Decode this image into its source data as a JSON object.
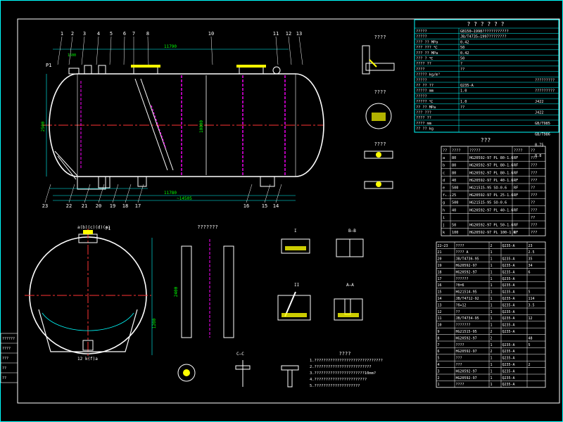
{
  "title_block": {
    "header": "? ? ? ? ? ?",
    "rows": [
      [
        "?????",
        "GB150—1998????????????"
      ],
      [
        "?????",
        "JB/T4735—1997????????"
      ],
      [
        "??? ?? MPa",
        "0.42"
      ],
      [
        "??? ??? ℃",
        "50"
      ],
      [
        "??? ?? MPa",
        "0.42"
      ],
      [
        "??? ? ℃",
        "50"
      ],
      [
        "???? ??",
        "?"
      ],
      [
        "????",
        "??"
      ],
      [
        "????? kg/m³",
        ""
      ],
      [
        "?????",
        ""
      ],
      [
        "?? ?? ??",
        "Q235-A"
      ],
      [
        "????? mm",
        "1.0"
      ],
      [
        "?????",
        ""
      ],
      [
        "????? ℃",
        "1.0"
      ],
      [
        "?? ?? MPa",
        "??"
      ],
      [
        "??? ???",
        ""
      ],
      [
        "???? ??",
        ""
      ],
      [
        "???? mm",
        ""
      ],
      [
        "?? ?? kg",
        ""
      ]
    ],
    "right_cells": [
      "?????????",
      "?????????",
      "J422",
      "J422",
      "GB/T985",
      "GB/T986",
      "0.75",
      "0.8"
    ]
  },
  "nozzle_table": {
    "title": "???",
    "headers": [
      "??",
      "????",
      "?????",
      "????",
      "??"
    ],
    "rows": [
      [
        "a",
        "80",
        "HG20592-97 PL 80-1.6",
        "RF",
        "???"
      ],
      [
        "b",
        "80",
        "HG20592-97 PL 80-1.6",
        "RF",
        "???"
      ],
      [
        "c",
        "80",
        "HG20592-97 PL 80-1.6",
        "RF",
        "???"
      ],
      [
        "d",
        "40",
        "HG20592-97 PL 40-1.6",
        "RF",
        "???"
      ],
      [
        "e",
        "500",
        "HG21515-95 SO-0.6",
        "RF",
        "??"
      ],
      [
        "f₁₋₃",
        "25",
        "HG20592-97 PL 25-1.6",
        "RF",
        "???"
      ],
      [
        "g",
        "500",
        "HG21515-95 SO-0.6",
        "",
        "??"
      ],
      [
        "h",
        "40",
        "HG20592-97 PL 40-1.6",
        "RF",
        "???"
      ],
      [
        "i",
        "",
        "",
        "",
        "??"
      ],
      [
        "j",
        "50",
        "HG20592-97 PL 50-1.6",
        "RF",
        "???"
      ],
      [
        "k",
        "100",
        "HG20592-97 PL 100-1.6",
        "RF",
        "???"
      ]
    ]
  },
  "parts_list": {
    "rows": [
      [
        "22—23",
        "????",
        "2",
        "Q235-A",
        "23"
      ],
      [
        "21",
        "???? A",
        "1",
        "",
        "2.5"
      ],
      [
        "20",
        "JB/T4736-95",
        "1",
        "Q235-A",
        "35"
      ],
      [
        "19",
        "HG20592-97",
        "1",
        "Q235-A",
        "34"
      ],
      [
        "18",
        "HG20592-97",
        "1",
        "Q235-A",
        "6"
      ],
      [
        "17",
        "??????",
        "1",
        "Q235-A",
        ""
      ],
      [
        "16",
        "?δ=6",
        "1",
        "Q235-A",
        ""
      ],
      [
        "15",
        "HG21514-95",
        "1",
        "Q235-A",
        "5"
      ],
      [
        "14",
        "JB/T4712-92",
        "1",
        "Q235-A",
        "114"
      ],
      [
        "13",
        "?δ=12",
        "1",
        "Q235-A",
        "3.5"
      ],
      [
        "12",
        "??",
        "1",
        "Q235-A",
        ""
      ],
      [
        "11",
        "JB/T4734-95",
        "1",
        "Q235-A",
        "12"
      ],
      [
        "10",
        "???????",
        "1",
        "Q235-A",
        ""
      ],
      [
        "9",
        "HG21515-95",
        "2",
        "Q235-A",
        ""
      ],
      [
        "8",
        "HG20592-97",
        "2",
        "",
        "48"
      ],
      [
        "7",
        "????",
        "1",
        "Q235-A",
        "5"
      ],
      [
        "6",
        "HG20592-97",
        "2",
        "Q235-A",
        ""
      ],
      [
        "5",
        "???",
        "1",
        "Q235-A",
        ""
      ],
      [
        "4",
        "???",
        "1",
        "Q235-A",
        "2"
      ],
      [
        "3",
        "HG20592-97",
        "1",
        "Q235-A",
        ""
      ],
      [
        "2",
        "HG20592-97",
        "1",
        "Q235-A",
        ""
      ],
      [
        "1",
        "????",
        "1",
        "Q235-A",
        ""
      ]
    ]
  },
  "main_view": {
    "part_numbers_top": [
      "1",
      "2",
      "3",
      "4",
      "5",
      "6",
      "7",
      "8",
      "10",
      "11",
      "12",
      "13"
    ],
    "part_numbers_bottom": [
      "23",
      "22",
      "21",
      "20",
      "19",
      "18",
      "17",
      "16",
      "15",
      "14"
    ],
    "dim_overall": "11790",
    "dim_length": "10800",
    "dim_height": "2500",
    "dim_bottom_total": "~14505",
    "dim_bottom_1": "11780",
    "label_p1": "P1",
    "nozzle_label": "1500"
  },
  "section_view": {
    "label_top": "a(b)(c)(d)(e)",
    "label_p1": "P1",
    "dim": "1200",
    "bottom_label": "12 k(f)a"
  },
  "detail_labels": {
    "d1": "????",
    "d2": "????",
    "d3": "????",
    "d4": "???????",
    "aa": "A—A",
    "bb": "B—B",
    "cc": "C—C",
    "ii": "I",
    "iii": "II",
    "view_gg": "?????",
    "dim_2400": "2400",
    "note_title": "????"
  },
  "notes": [
    "1.??????????????????????????????",
    "2.?????????????????????????",
    "3.??????????????????????10mm?",
    "4.???????????????????????",
    "5.????????????????????"
  ],
  "side_block": [
    "??????",
    "????",
    "???",
    "??",
    "??"
  ],
  "colors": {
    "background": "#000000",
    "frame": "#ffffff",
    "cyan": "#00ffff",
    "yellow": "#ffff00",
    "red": "#ff3333",
    "magenta": "#ff00ff",
    "green": "#00ff00"
  }
}
